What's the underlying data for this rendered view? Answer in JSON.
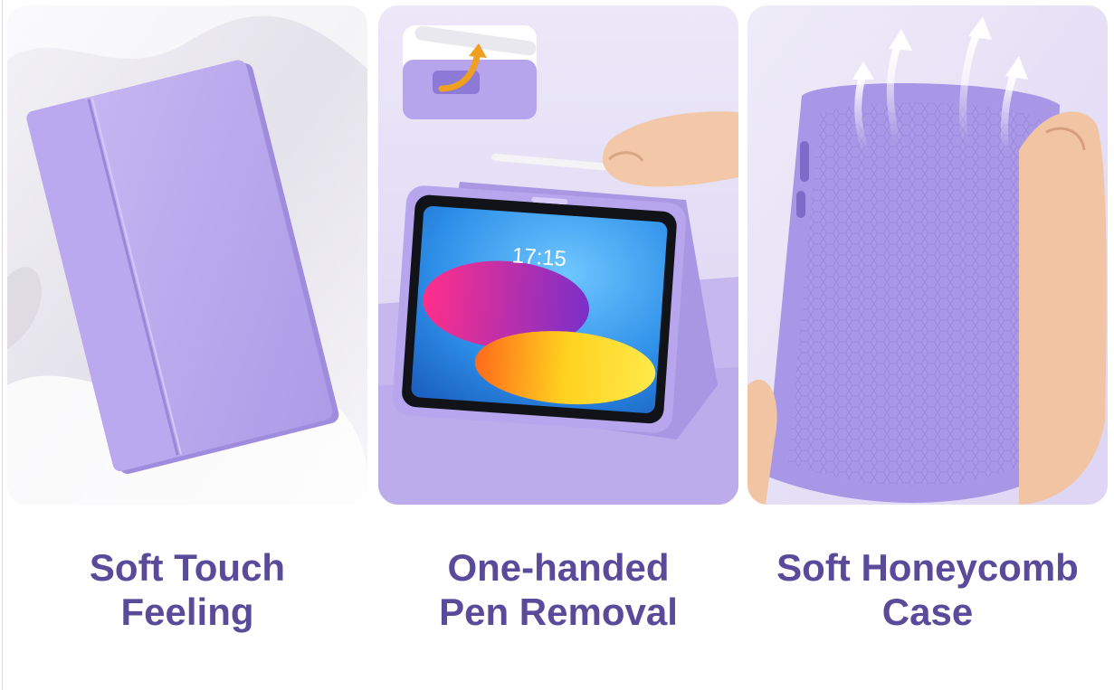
{
  "colors": {
    "caption_text": "#5a4a9a",
    "case_lavender": "#b9a8ee",
    "case_lavender_dark": "#9c89dc",
    "accent_arrow": "#f0a020"
  },
  "features": [
    {
      "line1": "Soft Touch",
      "line2": "Feeling",
      "illustration": "closed-tablet-case-on-fabric"
    },
    {
      "line1": "One-handed",
      "line2": "Pen Removal",
      "illustration": "tablet-in-case-with-pen"
    },
    {
      "line1": "Soft Honeycomb",
      "line2": "Case",
      "illustration": "honeycomb-inner-shell"
    }
  ],
  "tablet_screen": {
    "clock": "17:15"
  }
}
